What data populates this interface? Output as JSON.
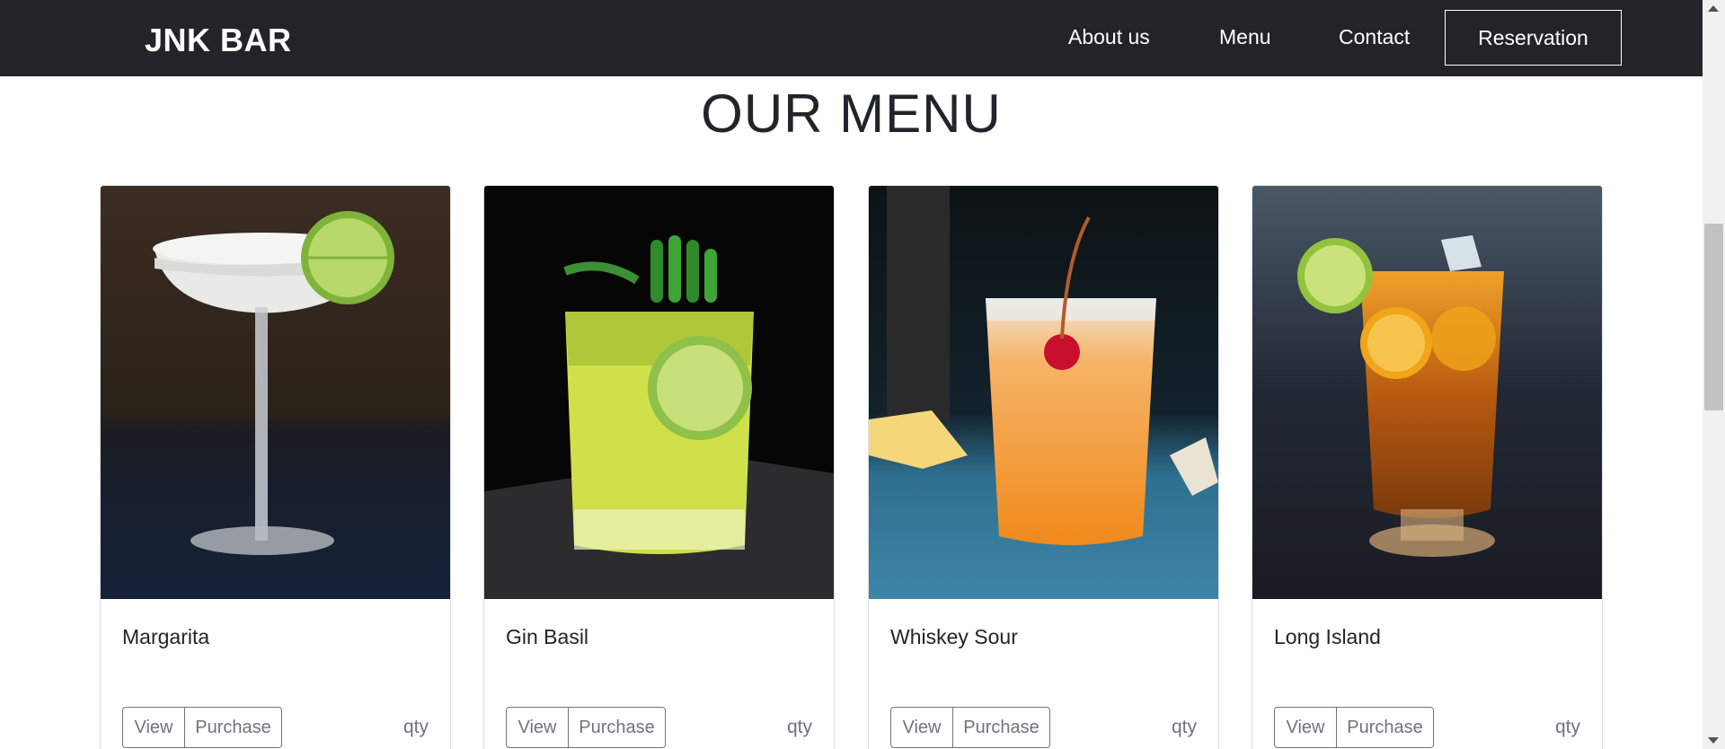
{
  "navbar": {
    "brand": "JNK BAR",
    "links": [
      {
        "label": "About us"
      },
      {
        "label": "Menu"
      },
      {
        "label": "Contact"
      }
    ],
    "reservation_label": "Reservation"
  },
  "section": {
    "title": "OUR MENU"
  },
  "items": [
    {
      "name": "Margarita",
      "view_label": "View",
      "purchase_label": "Purchase",
      "qty_label": "qty",
      "image": "margarita-photo"
    },
    {
      "name": "Gin Basil",
      "view_label": "View",
      "purchase_label": "Purchase",
      "qty_label": "qty",
      "image": "gin-basil-photo"
    },
    {
      "name": "Whiskey Sour",
      "view_label": "View",
      "purchase_label": "Purchase",
      "qty_label": "qty",
      "image": "whiskey-sour-photo"
    },
    {
      "name": "Long Island",
      "view_label": "View",
      "purchase_label": "Purchase",
      "qty_label": "qty",
      "image": "long-island-photo"
    }
  ],
  "colors": {
    "navbar_bg": "#212529",
    "text_dark": "#212529",
    "button_outline": "#6c757d"
  }
}
